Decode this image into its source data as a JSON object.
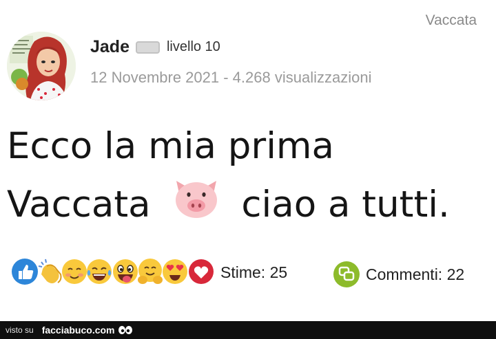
{
  "header": {
    "category": "Vaccata"
  },
  "post": {
    "author": "Jade",
    "level": "livello 10",
    "meta": "12 Novembre 2021 - 4.268 visualizzazioni",
    "line1": "Ecco la mia prima",
    "line2_before": "Vaccata",
    "line2_after": "ciao a tutti."
  },
  "stats": {
    "likes": "Stime: 25",
    "comments": "Commenti: 22"
  },
  "reaction_icons": [
    "thumbs-up-icon",
    "clapping-hands-icon",
    "smiling-blush-icon",
    "tears-of-joy-icon",
    "tongue-out-icon",
    "hugging-icon",
    "heart-eyes-icon",
    "heart-icon"
  ],
  "footer": {
    "prefix": "visto su",
    "site": "facciabuco.com"
  },
  "colors": {
    "text": "#151515",
    "muted": "#9a9a9a",
    "like_blue": "#2d86d9",
    "comment_green": "#8dbb2b",
    "heart_red": "#d8283a",
    "footer_bg": "#0f0f0f"
  }
}
